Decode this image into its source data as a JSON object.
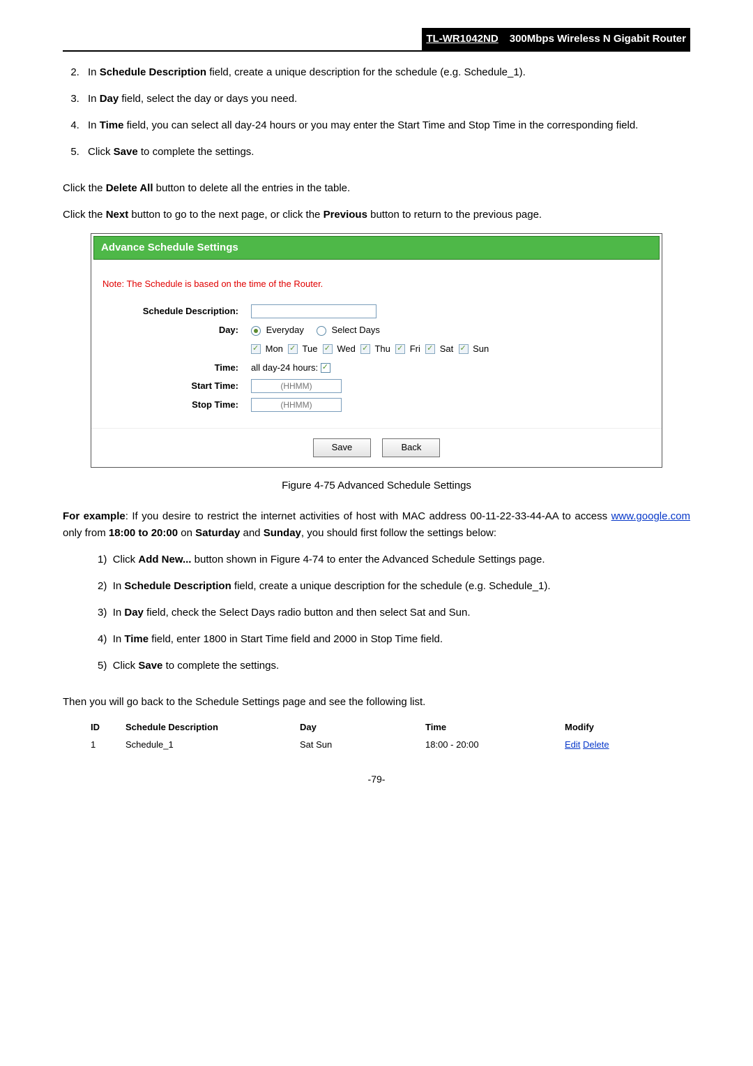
{
  "header": {
    "model": "TL-WR1042ND",
    "desc": "300Mbps Wireless N Gigabit Router"
  },
  "steps_top": [
    {
      "n": "2.",
      "html": "In <b>Schedule Description</b> field, create a unique description for the schedule (e.g. Schedule_1)."
    },
    {
      "n": "3.",
      "html": "In <b>Day</b> field, select the day or days you need."
    },
    {
      "n": "4.",
      "html": "In <b>Time</b> field, you can select all day-24 hours or you may enter the Start Time and Stop Time in the corresponding field."
    },
    {
      "n": "5.",
      "html": "Click <b>Save</b> to complete the settings."
    }
  ],
  "para_delete": "Click the <b>Delete All</b> button to delete all the entries in the table.",
  "para_next": "Click the <b>Next</b> button to go to the next page, or click the <b>Previous</b> button to return to the previous page.",
  "panel": {
    "title": "Advance Schedule Settings",
    "note": "Note: The Schedule is based on the time of the Router.",
    "labels": {
      "desc": "Schedule Description:",
      "day": "Day:",
      "time": "Time:",
      "start": "Start Time:",
      "stop": "Stop Time:"
    },
    "day_opts": {
      "everyday": "Everyday",
      "select": "Select Days"
    },
    "days": [
      "Mon",
      "Tue",
      "Wed",
      "Thu",
      "Fri",
      "Sat",
      "Sun"
    ],
    "time_allday": "all day-24 hours:",
    "hhmm": "(HHMM)",
    "save": "Save",
    "back": "Back"
  },
  "fig_caption": "Figure 4-75   Advanced Schedule Settings",
  "example_pre": "For example",
  "example_body": ": If you desire to restrict the internet activities of host with MAC address 00-11-22-33-44-AA to access ",
  "example_link": "www.google.com",
  "example_tail": " only from <b>18:00 to 20:00</b> on <b>Saturday</b> and <b>Sunday</b>, you should first follow the settings below:",
  "steps_sub": [
    {
      "n": "1)",
      "html": "Click <b>Add New...</b> button shown in Figure 4-74 to enter the Advanced Schedule Settings page."
    },
    {
      "n": "2)",
      "html": "In <b>Schedule Description</b> field, create a unique description for the schedule (e.g. Schedule_1)."
    },
    {
      "n": "3)",
      "html": "In <b>Day</b> field, check the Select Days radio button and then select Sat and Sun."
    },
    {
      "n": "4)",
      "html": "In <b>Time</b> field, enter 1800 in Start Time field and 2000 in Stop Time field."
    },
    {
      "n": "5)",
      "html": "Click <b>Save</b> to complete the settings."
    }
  ],
  "para_then": "Then you will go back to the Schedule Settings page and see the following list.",
  "table": {
    "headers": {
      "id": "ID",
      "desc": "Schedule Description",
      "day": "Day",
      "time": "Time",
      "mod": "Modify"
    },
    "row": {
      "id": "1",
      "desc": "Schedule_1",
      "day": "Sat Sun",
      "time": "18:00 - 20:00",
      "edit": "Edit",
      "del": "Delete"
    }
  },
  "page_num": "-79-"
}
